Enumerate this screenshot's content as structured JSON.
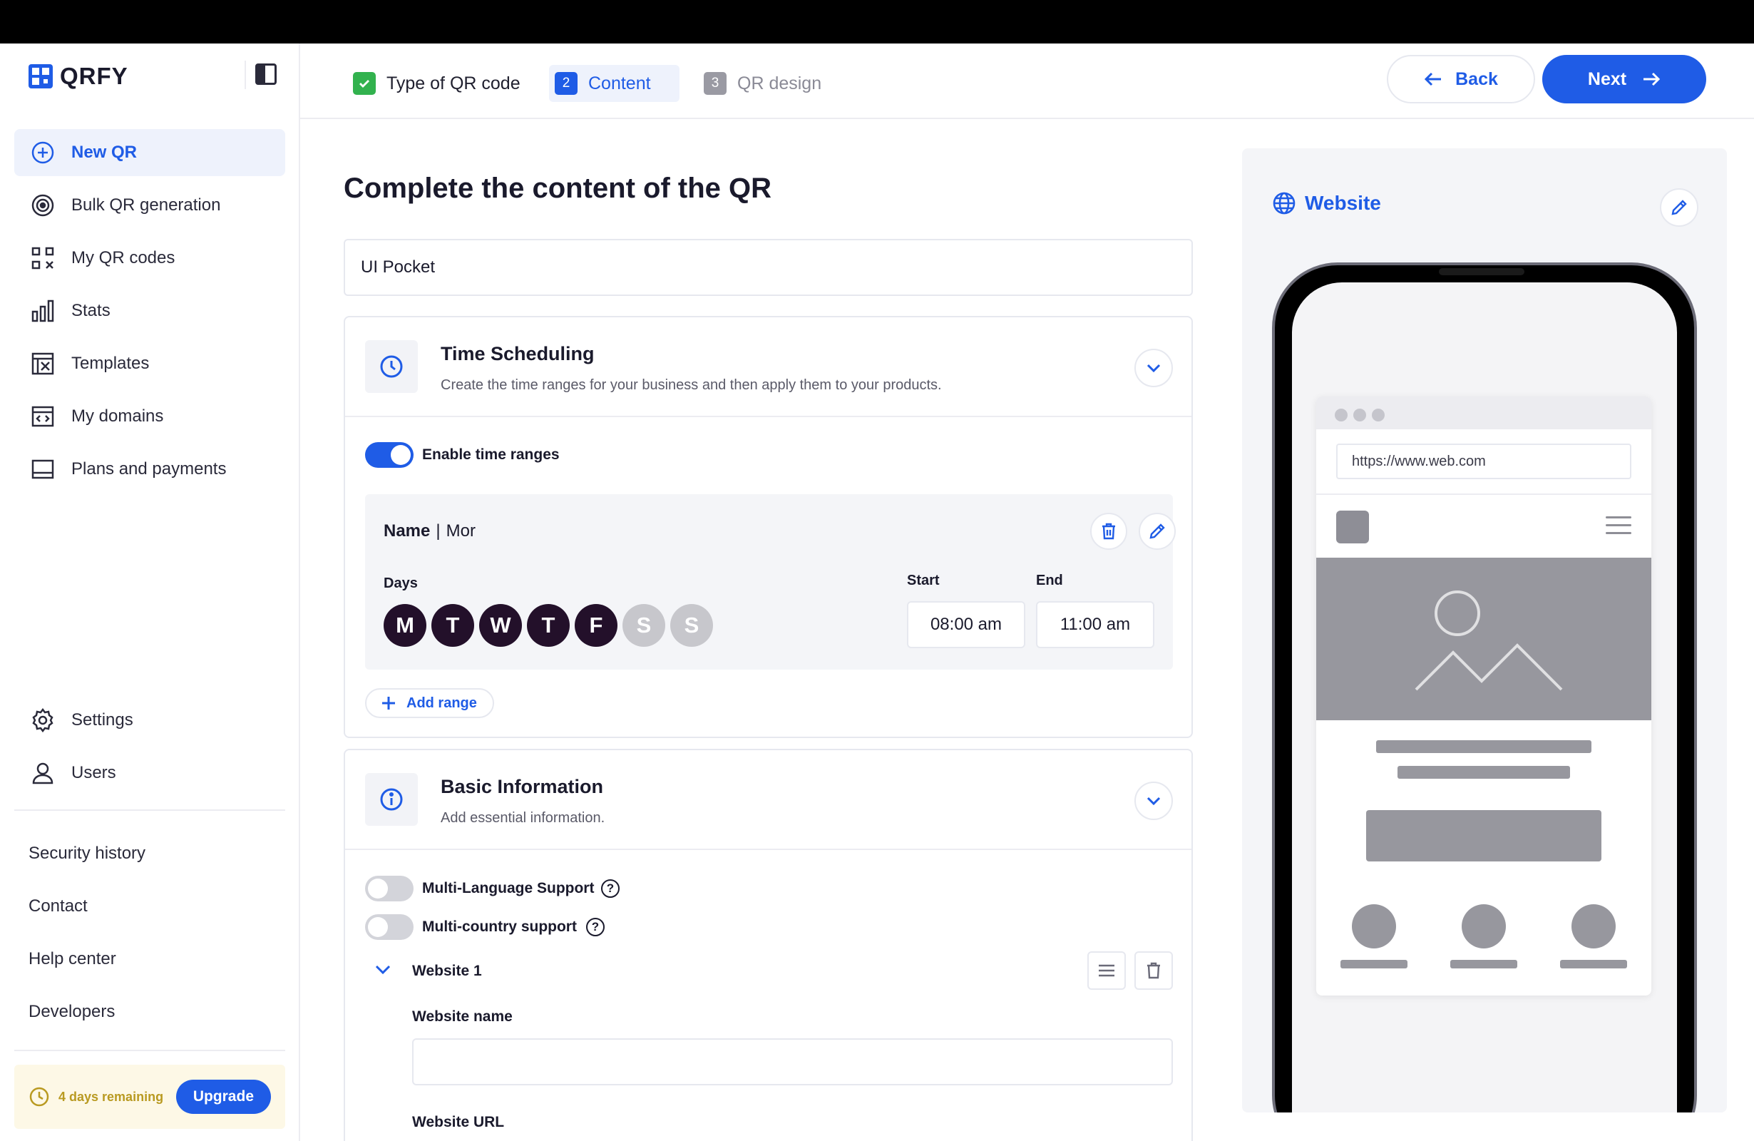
{
  "app": {
    "logo_text": "QRFY"
  },
  "sidebar": {
    "nav": [
      {
        "label": "New QR",
        "icon": "plus-circle-icon",
        "active": true
      },
      {
        "label": "Bulk QR generation",
        "icon": "target-icon"
      },
      {
        "label": "My QR codes",
        "icon": "qr-grid-icon"
      },
      {
        "label": "Stats",
        "icon": "bar-chart-icon"
      },
      {
        "label": "Templates",
        "icon": "template-icon"
      },
      {
        "label": "My domains",
        "icon": "domain-icon"
      },
      {
        "label": "Plans and payments",
        "icon": "card-icon"
      }
    ],
    "settings_label": "Settings",
    "users_label": "Users",
    "footer_links": [
      "Security history",
      "Contact",
      "Help center",
      "Developers"
    ],
    "trial_text": "4 days remaining",
    "upgrade_label": "Upgrade"
  },
  "header": {
    "steps": [
      {
        "num": "✓",
        "label": "Type of QR code",
        "state": "done"
      },
      {
        "num": "2",
        "label": "Content",
        "state": "current"
      },
      {
        "num": "3",
        "label": "QR design",
        "state": "todo"
      }
    ],
    "back_label": "Back",
    "next_label": "Next"
  },
  "main": {
    "title": "Complete the content of the QR",
    "qr_name_value": "UI Pocket",
    "time_card": {
      "title": "Time Scheduling",
      "subtitle": "Create the time ranges for your business and then apply them to your products.",
      "toggle_label": "Enable time ranges",
      "toggle_on": true,
      "range": {
        "name_label": "Name",
        "name_sep": "|",
        "name_value": "Mor",
        "days_label": "Days",
        "days": [
          {
            "letter": "M",
            "on": true
          },
          {
            "letter": "T",
            "on": true
          },
          {
            "letter": "W",
            "on": true
          },
          {
            "letter": "T",
            "on": true
          },
          {
            "letter": "F",
            "on": true
          },
          {
            "letter": "S",
            "on": false
          },
          {
            "letter": "S",
            "on": false
          }
        ],
        "start_label": "Start",
        "end_label": "End",
        "start_value": "08:00 am",
        "end_value": "11:00 am"
      },
      "add_range_label": "Add range"
    },
    "basic_card": {
      "title": "Basic Information",
      "subtitle": "Add essential information.",
      "multi_language_label": "Multi-Language Support",
      "multi_country_label": "Multi-country support",
      "help_glyph": "?",
      "website_item_label": "Website 1",
      "website_name_label": "Website name",
      "website_url_label": "Website URL"
    }
  },
  "preview": {
    "title": "Website",
    "url": "https://www.web.com"
  },
  "colors": {
    "accent": "#1f5ce6",
    "done_green": "#32b24e",
    "day_active": "#23102a",
    "day_inactive": "#c7c7cc",
    "trial_bg": "#fdf8e6",
    "trial_text": "#b99a21"
  }
}
